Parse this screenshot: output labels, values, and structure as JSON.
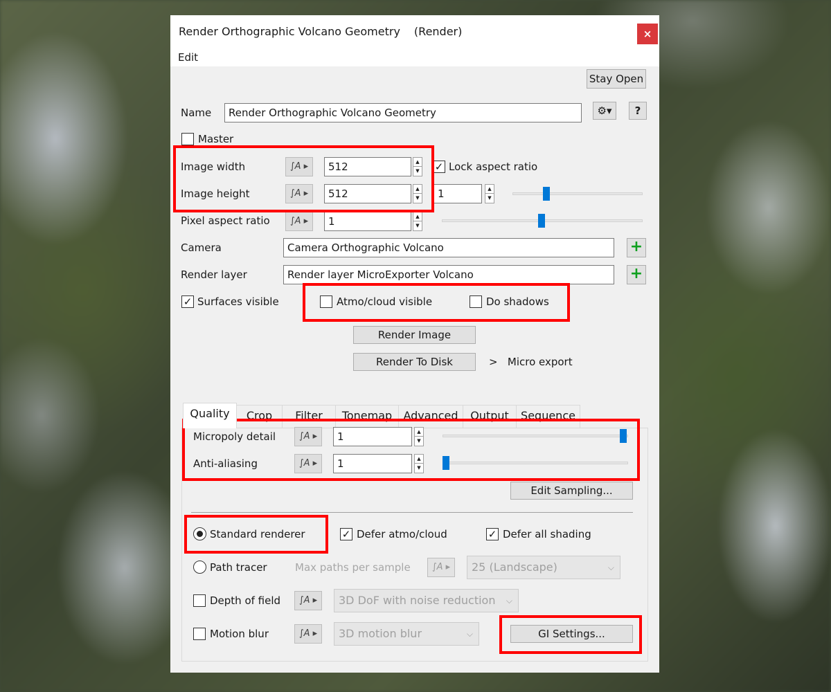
{
  "window": {
    "title": "Render Orthographic Volcano Geometry",
    "subtitle": "(Render)",
    "close_glyph": "×",
    "menu": {
      "edit": "Edit"
    }
  },
  "toolbar": {
    "stay_open": "Stay Open"
  },
  "name_row": {
    "label": "Name",
    "value": "Render Orthographic Volcano Geometry",
    "settings_icon": "gear-icon",
    "help": "?"
  },
  "master": {
    "label": "Master",
    "checked": false
  },
  "image_width": {
    "label": "Image width",
    "value": "512"
  },
  "image_height": {
    "label": "Image height",
    "value": "512"
  },
  "lock_aspect": {
    "label": "Lock aspect ratio",
    "checked": true
  },
  "scale_value": "1",
  "pixel_aspect": {
    "label": "Pixel aspect ratio",
    "value": "1"
  },
  "camera": {
    "label": "Camera",
    "value": "Camera Orthographic Volcano"
  },
  "render_layer": {
    "label": "Render layer",
    "value": "Render layer MicroExporter Volcano"
  },
  "visibility": {
    "surfaces": {
      "label": "Surfaces visible",
      "checked": true
    },
    "atmo": {
      "label": "Atmo/cloud visible",
      "checked": false
    },
    "shadows": {
      "label": "Do shadows",
      "checked": false
    }
  },
  "actions": {
    "render_image": "Render Image",
    "render_to_disk": "Render To Disk",
    "micro_export": ">   Micro export"
  },
  "tabs": [
    "Quality",
    "Crop",
    "Filter",
    "Tonemap",
    "Advanced",
    "Output",
    "Sequence"
  ],
  "active_tab": "Quality",
  "quality": {
    "micropoly": {
      "label": "Micropoly detail",
      "value": "1",
      "slider": 1.0
    },
    "antialias": {
      "label": "Anti-aliasing",
      "value": "1",
      "slider": 0.0
    },
    "edit_sampling": "Edit Sampling...",
    "standard_renderer": {
      "label": "Standard renderer",
      "selected": true
    },
    "defer_atmo": {
      "label": "Defer atmo/cloud",
      "checked": true
    },
    "defer_shading": {
      "label": "Defer all shading",
      "checked": true
    },
    "path_tracer": {
      "label": "Path tracer",
      "selected": false
    },
    "max_paths": {
      "label": "Max paths per sample",
      "value": "25 (Landscape)"
    },
    "dof": {
      "label": "Depth of field",
      "value": "3D DoF with noise reduction",
      "checked": false
    },
    "motion_blur": {
      "label": "Motion blur",
      "value": "3D motion blur",
      "checked": false
    },
    "gi_settings": "GI Settings..."
  },
  "anim_button_glyph": "∫A ▸",
  "colors": {
    "accent": "#0078d7",
    "highlight": "#ff0000",
    "close": "#d9383b"
  }
}
